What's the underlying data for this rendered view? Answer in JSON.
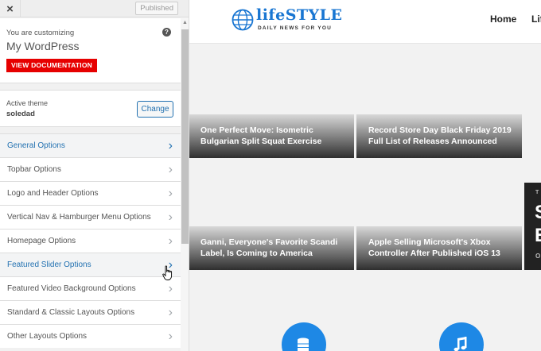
{
  "topbar": {
    "close": "×",
    "published": "Published"
  },
  "info": {
    "customizing_label": "You are customizing",
    "site_name": "My WordPress",
    "help": "?",
    "doc_button": "VIEW DOCUMENTATION"
  },
  "theme": {
    "label": "Active theme",
    "name": "soledad",
    "change": "Change"
  },
  "menu": {
    "items": [
      {
        "label": "General Options",
        "highlighted": true
      },
      {
        "label": "Topbar Options",
        "highlighted": false
      },
      {
        "label": "Logo and Header Options",
        "highlighted": false
      },
      {
        "label": "Vertical Nav & Hamburger Menu Options",
        "highlighted": false
      },
      {
        "label": "Homepage Options",
        "highlighted": false
      },
      {
        "label": "Featured Slider Options",
        "highlighted": true
      },
      {
        "label": "Featured Video Background Options",
        "highlighted": false
      },
      {
        "label": "Standard & Classic Layouts Options",
        "highlighted": false
      },
      {
        "label": "Other Layouts Options",
        "highlighted": false
      }
    ]
  },
  "preview": {
    "logo": {
      "name": "lifeSTYLE",
      "tagline": "DAILY NEWS FOR YOU"
    },
    "nav": {
      "home": "Home",
      "life": "Lif"
    },
    "cards": [
      {
        "line1": "One Perfect Move: Isometric",
        "line2": "Bulgarian Split Squat Exercise"
      },
      {
        "line1": "Record Store Day Black Friday 2019",
        "line2": "Full List of Releases Announced"
      },
      {
        "line1": "Ganni, Everyone's Favorite Scandi",
        "line2": "Label, Is Coming to America"
      },
      {
        "line1": "Apple Selling Microsoft's Xbox",
        "line2": "Controller After Published iOS 13"
      }
    ],
    "side_card": {
      "top": "T",
      "l1": "S",
      "l2": "E",
      "bottom": "O"
    }
  },
  "colors": {
    "accent": "#2271b1",
    "doc_button": "#e60000",
    "brand": "#1976d2"
  }
}
